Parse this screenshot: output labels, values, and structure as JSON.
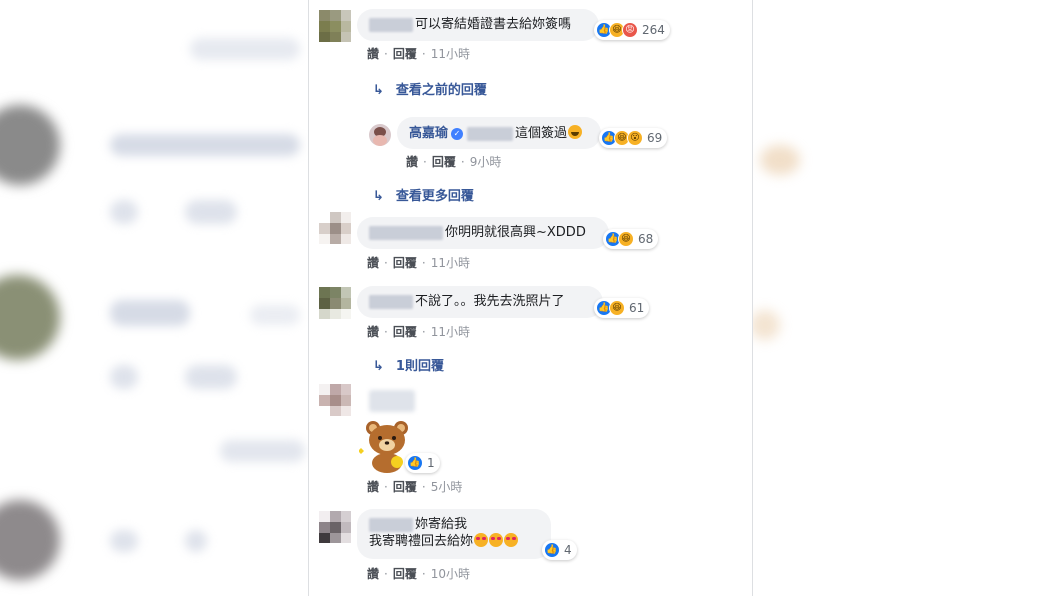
{
  "ui": {
    "like": "讚",
    "reply": "回覆",
    "sep": "·"
  },
  "comments": [
    {
      "text": "可以寄結婚證書去給妳簽嗎",
      "reactions_count": "264",
      "time": "11小時"
    },
    {
      "text": "你明明就很高興~XDDD",
      "reactions_count": "68",
      "time": "11小時"
    },
    {
      "text": "不說了。。我先去洗照片了",
      "reactions_count": "61",
      "time": "11小時"
    },
    {
      "reactions_count": "1",
      "time": "5小時"
    },
    {
      "line1": "妳寄給我",
      "line2": "我寄聘禮回去給妳",
      "reactions_count": "4",
      "time": "10小時"
    }
  ],
  "view_previous": "查看之前的回覆",
  "reply_thread": {
    "name": "高嘉瑜",
    "text": "這個簽過",
    "reactions_count": "69",
    "time": "9小時"
  },
  "view_more": "查看更多回覆",
  "one_reply": "1則回覆",
  "colors": {
    "link": "#385898",
    "bubble": "#f2f3f5",
    "like": "#1877f2",
    "meta": "#90949c"
  },
  "icons": [
    "reply-arrow-icon",
    "like-reaction-icon",
    "haha-reaction-icon",
    "angry-reaction-icon",
    "wow-reaction-icon",
    "verified-badge-icon",
    "bear-sticker"
  ]
}
